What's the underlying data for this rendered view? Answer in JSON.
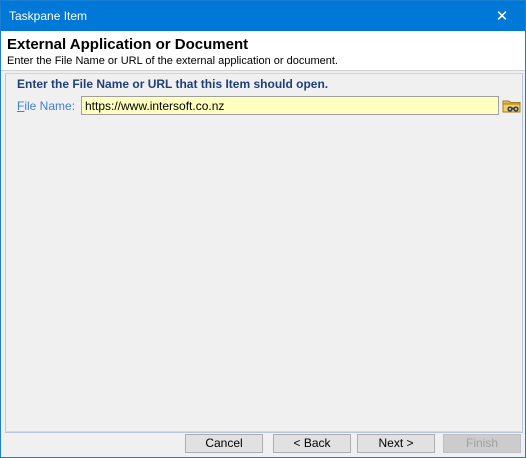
{
  "window": {
    "title": "Taskpane Item",
    "close_glyph": "✕"
  },
  "header": {
    "title": "External Application or Document",
    "subtitle": "Enter the File Name or URL of the external application or document."
  },
  "form": {
    "instruction": "Enter the File Name or URL that this Item should open.",
    "file_label_prefix": "",
    "file_label_accel": "F",
    "file_label_rest": "ile Name:",
    "file_value": "https://www.intersoft.co.nz",
    "browse_icon": "binoculars-folder-icon"
  },
  "buttons": {
    "cancel": "Cancel",
    "back": "< Back",
    "next": "Next >",
    "finish": "Finish"
  },
  "colors": {
    "titlebar": "#0078d7",
    "input_bg": "#ffffc0",
    "label": "#3d7fd1",
    "instruction": "#1f3f7a"
  }
}
